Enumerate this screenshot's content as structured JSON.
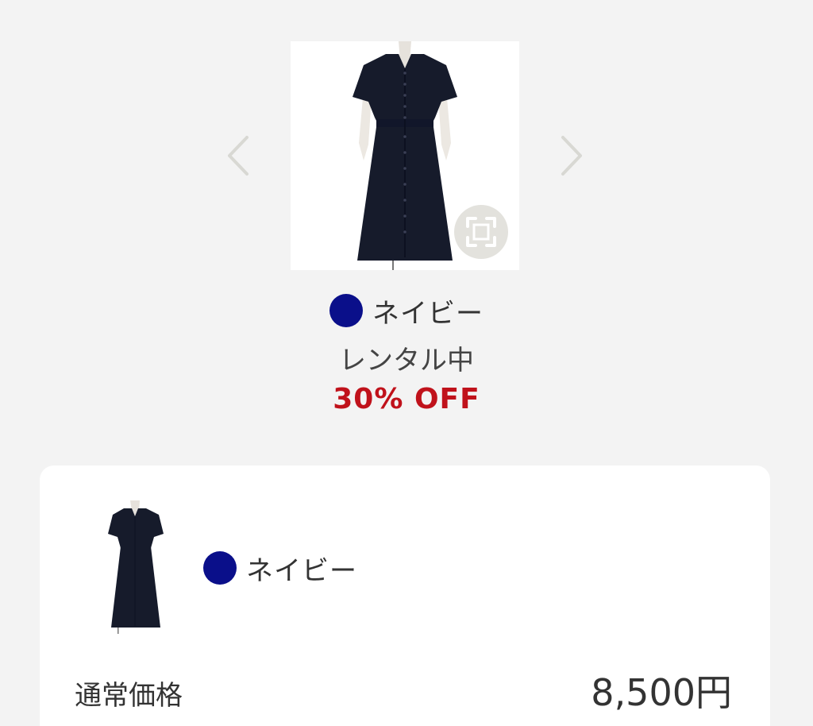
{
  "product": {
    "color_name": "ネイビー",
    "color_hex": "#0a0f8a",
    "status": "レンタル中",
    "discount": "30% OFF"
  },
  "carousel": {
    "prev_icon": "chevron-left-icon",
    "next_icon": "chevron-right-icon",
    "zoom_icon": "expand-icon"
  },
  "card": {
    "color_name": "ネイビー",
    "price_label": "通常価格",
    "price_value": "8,500円"
  },
  "colors": {
    "discount": "#c0121b",
    "background": "#f3f3f3",
    "dress": "#161b2b"
  }
}
